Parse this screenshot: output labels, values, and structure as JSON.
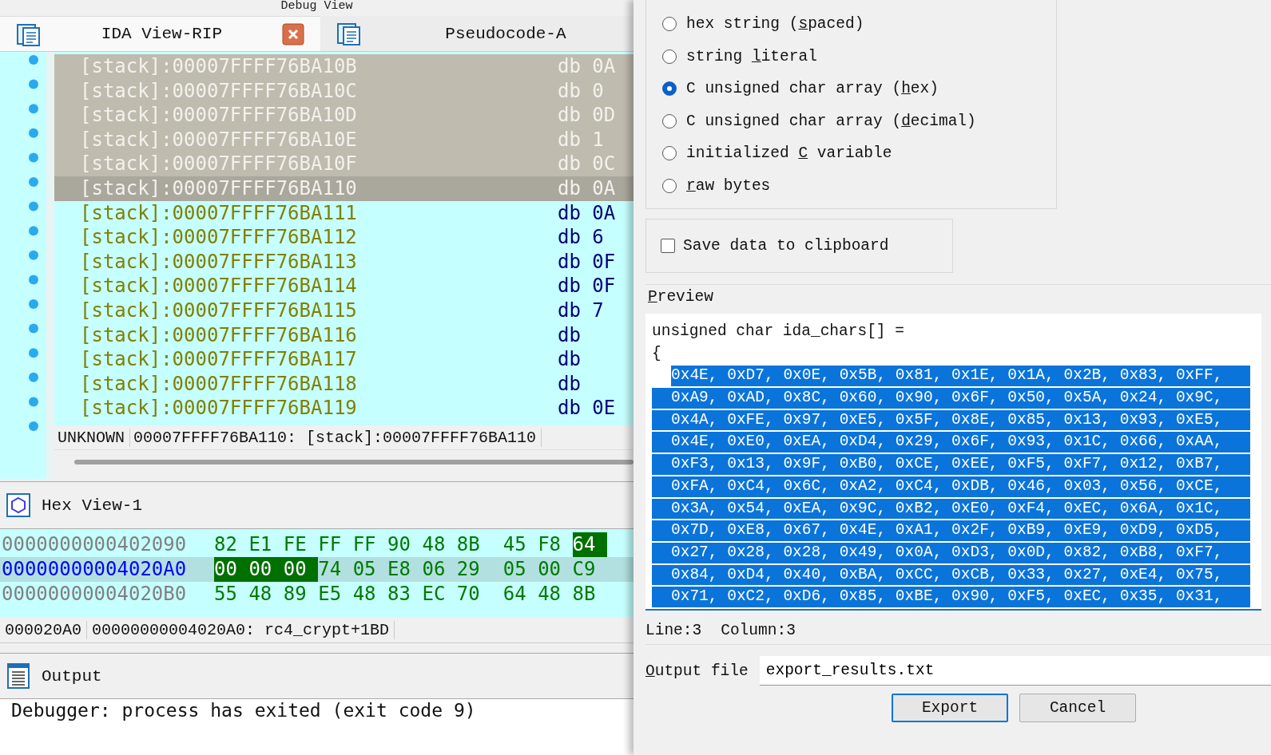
{
  "debug_view": {
    "title": "Debug View"
  },
  "tabs": [
    {
      "label": "IDA View-RIP",
      "selected": true,
      "closable": true
    },
    {
      "label": "Pseudocode-A",
      "selected": false,
      "closable": false
    }
  ],
  "listing": {
    "rows": [
      {
        "address": "[stack]:00007FFFF76BA10B",
        "mnemonic": "db",
        "operand": "0A",
        "selected": true,
        "current": false
      },
      {
        "address": "[stack]:00007FFFF76BA10C",
        "mnemonic": "db",
        "operand": " 0",
        "selected": true,
        "current": false
      },
      {
        "address": "[stack]:00007FFFF76BA10D",
        "mnemonic": "db",
        "operand": "0D",
        "selected": true,
        "current": false
      },
      {
        "address": "[stack]:00007FFFF76BA10E",
        "mnemonic": "db",
        "operand": " 1",
        "selected": true,
        "current": false
      },
      {
        "address": "[stack]:00007FFFF76BA10F",
        "mnemonic": "db",
        "operand": "0C",
        "selected": true,
        "current": false
      },
      {
        "address": "[stack]:00007FFFF76BA110",
        "mnemonic": "db",
        "operand": "0A",
        "selected": true,
        "current": true
      },
      {
        "address": "[stack]:00007FFFF76BA111",
        "mnemonic": "db",
        "operand": "0A",
        "selected": false,
        "current": false
      },
      {
        "address": "[stack]:00007FFFF76BA112",
        "mnemonic": "db",
        "operand": " 6",
        "selected": false,
        "current": false
      },
      {
        "address": "[stack]:00007FFFF76BA113",
        "mnemonic": "db",
        "operand": "0F",
        "selected": false,
        "current": false
      },
      {
        "address": "[stack]:00007FFFF76BA114",
        "mnemonic": "db",
        "operand": "0F",
        "selected": false,
        "current": false
      },
      {
        "address": "[stack]:00007FFFF76BA115",
        "mnemonic": "db",
        "operand": " 7",
        "selected": false,
        "current": false
      },
      {
        "address": "[stack]:00007FFFF76BA116",
        "mnemonic": "db",
        "selected": false,
        "current": false
      },
      {
        "address": "[stack]:00007FFFF76BA117",
        "mnemonic": "db",
        "selected": false,
        "current": false
      },
      {
        "address": "[stack]:00007FFFF76BA118",
        "mnemonic": "db",
        "selected": false,
        "current": false
      },
      {
        "address": "[stack]:00007FFFF76BA119",
        "mnemonic": "db",
        "operand": "0E",
        "selected": false,
        "current": false
      }
    ],
    "status": [
      "UNKNOWN",
      "00007FFFF76BA110: [stack]:00007FFFF76BA110"
    ]
  },
  "hex_view": {
    "title": "Hex View-1",
    "rows": [
      {
        "address": "0000000000402090",
        "selected": false,
        "bytes": [
          {
            "text": "82",
            "highlighted": false
          },
          {
            "text": "E1",
            "highlighted": false
          },
          {
            "text": "FE",
            "highlighted": false
          },
          {
            "text": "FF",
            "highlighted": false
          },
          {
            "text": "FF",
            "highlighted": false
          },
          {
            "text": "90",
            "highlighted": false
          },
          {
            "text": "48",
            "highlighted": false
          },
          {
            "text": "8B",
            "highlighted": false
          },
          {
            "text": "45",
            "highlighted": false
          },
          {
            "text": "F8",
            "highlighted": false
          },
          {
            "text": "64",
            "highlighted": true
          }
        ]
      },
      {
        "address": "00000000004020A0",
        "selected": true,
        "bytes": [
          {
            "text": "00",
            "highlighted": true
          },
          {
            "text": "00",
            "highlighted": true
          },
          {
            "text": "00",
            "highlighted": true
          },
          {
            "text": "74",
            "highlighted": false
          },
          {
            "text": "05",
            "highlighted": false
          },
          {
            "text": "E8",
            "highlighted": false
          },
          {
            "text": "06",
            "highlighted": false
          },
          {
            "text": "29",
            "highlighted": false
          },
          {
            "text": "05",
            "highlighted": false
          },
          {
            "text": "00",
            "highlighted": false
          },
          {
            "text": "C9",
            "highlighted": false
          }
        ]
      },
      {
        "address": "00000000004020B0",
        "selected": false,
        "bytes": [
          {
            "text": "55",
            "highlighted": false
          },
          {
            "text": "48",
            "highlighted": false
          },
          {
            "text": "89",
            "highlighted": false
          },
          {
            "text": "E5",
            "highlighted": false
          },
          {
            "text": "48",
            "highlighted": false
          },
          {
            "text": "83",
            "highlighted": false
          },
          {
            "text": "EC",
            "highlighted": false
          },
          {
            "text": "70",
            "highlighted": false
          },
          {
            "text": "64",
            "highlighted": false
          },
          {
            "text": "48",
            "highlighted": false
          },
          {
            "text": "8B",
            "highlighted": false
          }
        ]
      }
    ],
    "status": [
      "000020A0",
      "00000000004020A0: rc4_crypt+1BD"
    ]
  },
  "output": {
    "title": "Output",
    "lines": [
      "Debugger: process has exited (exit code 9)"
    ]
  },
  "export_dialog": {
    "formats": [
      {
        "label": {
          "before": "hex string (",
          "key": "s",
          "after": "paced)"
        },
        "selected": false
      },
      {
        "label": {
          "before": "string ",
          "key": "l",
          "after": "iteral"
        },
        "selected": false
      },
      {
        "label": {
          "before": "C unsigned char array (",
          "key": "h",
          "after": "ex)"
        },
        "selected": true
      },
      {
        "label": {
          "before": "C unsigned char array (",
          "key": "d",
          "after": "ecimal)"
        },
        "selected": false
      },
      {
        "label": {
          "before": "initialized ",
          "key": "C",
          "after": " variable"
        },
        "selected": false
      },
      {
        "label": {
          "key": "r",
          "after": "aw bytes"
        },
        "selected": false
      }
    ],
    "save_to_clipboard": {
      "label": "Save data to clipboard",
      "checked": false
    },
    "preview": {
      "label": {
        "key": "P",
        "after": "review"
      },
      "lines": [
        {
          "text": "unsigned char ida_chars[] =",
          "selected": false
        },
        {
          "text": "{",
          "selected": false
        },
        {
          "text": "0x4E, 0xD7, 0x0E, 0x5B, 0x81, 0x1E, 0x1A, 0x2B, 0x83, 0xFF,",
          "selected": true
        },
        {
          "text": "0xA9, 0xAD, 0x8C, 0x60, 0x90, 0x6F, 0x50, 0x5A, 0x24, 0x9C,",
          "selected": true
        },
        {
          "text": "0x4A, 0xFE, 0x97, 0xE5, 0x5F, 0x8E, 0x85, 0x13, 0x93, 0xE5,",
          "selected": true
        },
        {
          "text": "0x4E, 0xE0, 0xEA, 0xD4, 0x29, 0x6F, 0x93, 0x1C, 0x66, 0xAA,",
          "selected": true
        },
        {
          "text": "0xF3, 0x13, 0x9F, 0xB0, 0xCE, 0xEE, 0xF5, 0xF7, 0x12, 0xB7,",
          "selected": true
        },
        {
          "text": "0xFA, 0xC4, 0x6C, 0xA2, 0xC4, 0xDB, 0x46, 0x03, 0x56, 0xCE,",
          "selected": true
        },
        {
          "text": "0x3A, 0x54, 0xEA, 0x9C, 0xB2, 0xE0, 0xF4, 0xEC, 0x6A, 0x1C,",
          "selected": true
        },
        {
          "text": "0x7D, 0xE8, 0x67, 0x4E, 0xA1, 0x2F, 0xB9, 0xE9, 0xD9, 0xD5,",
          "selected": true
        },
        {
          "text": "0x27, 0x28, 0x28, 0x49, 0x0A, 0xD3, 0x0D, 0x82, 0xB8, 0xF7,",
          "selected": true
        },
        {
          "text": "0x84, 0xD4, 0x40, 0xBA, 0xCC, 0xCB, 0x33, 0x27, 0xE4, 0x75,",
          "selected": true
        },
        {
          "text": "0x71, 0xC2, 0xD6, 0x85, 0xBE, 0x90, 0xF5, 0xEC, 0x35, 0x31,",
          "selected": true
        }
      ]
    },
    "cursor": [
      "Line:3",
      "Column:3"
    ],
    "output_file": {
      "label": {
        "key": "O",
        "after": "utput file"
      },
      "value": "export_results.txt"
    },
    "buttons": [
      {
        "label": "Export",
        "default": true
      },
      {
        "label": "Cancel",
        "default": false
      }
    ]
  }
}
